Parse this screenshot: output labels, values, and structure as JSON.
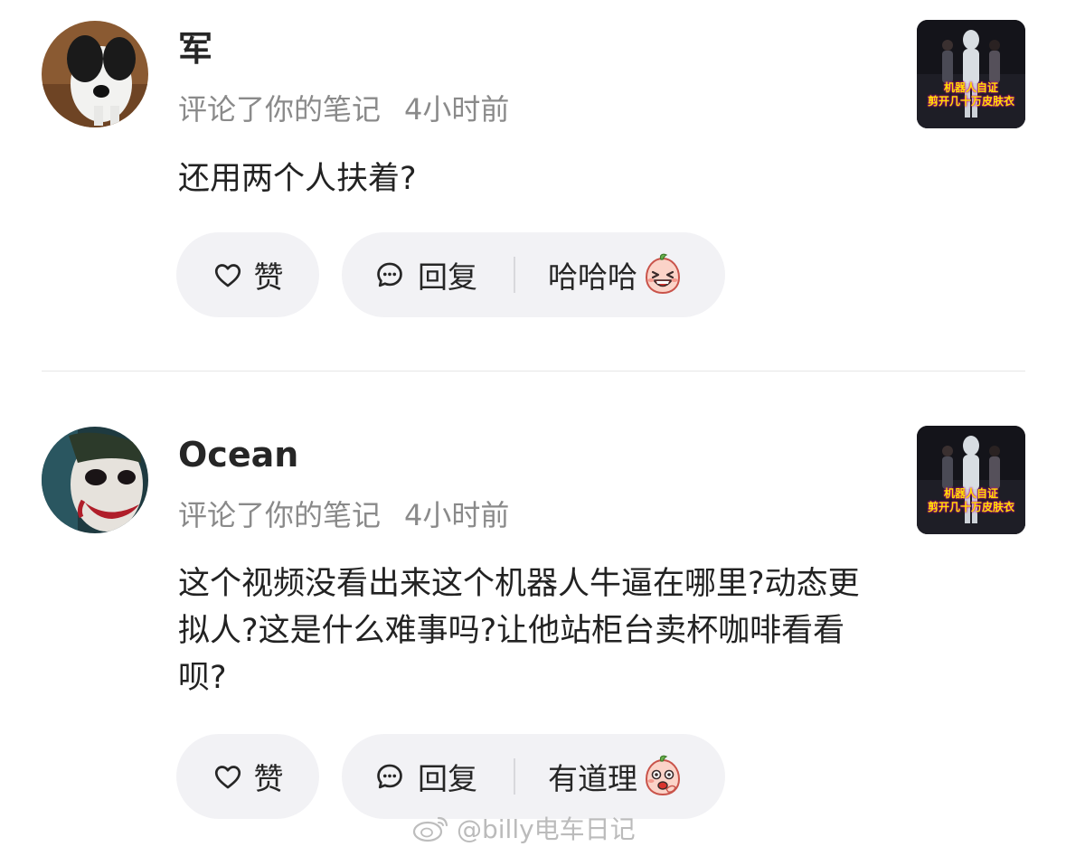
{
  "comments": [
    {
      "user": "军",
      "action": "评论了你的笔记",
      "time": "4小时前",
      "text": "还用两个人扶着?",
      "like_label": "赞",
      "reply_label": "回复",
      "quick_reply": "哈哈哈",
      "quick_reply_emoji": "laughing-peach-emoji",
      "avatar_icon": "dog-avatar",
      "thumb_caption_line1": "机器人自证",
      "thumb_caption_line2": "剪开几十万皮肤衣"
    },
    {
      "user": "Ocean",
      "action": "评论了你的笔记",
      "time": "4小时前",
      "text": "这个视频没看出来这个机器人牛逼在哪里?动态更拟人?这是什么难事吗?让他站柜台卖杯咖啡看看呗?",
      "like_label": "赞",
      "reply_label": "回复",
      "quick_reply": "有道理",
      "quick_reply_emoji": "thinking-peach-emoji",
      "avatar_icon": "joker-avatar",
      "thumb_caption_line1": "机器人自证",
      "thumb_caption_line2": "剪开几十万皮肤衣"
    }
  ],
  "watermark": "@billy电车日记"
}
